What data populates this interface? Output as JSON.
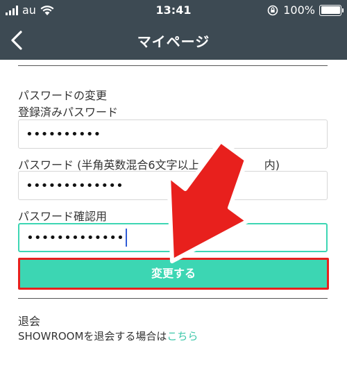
{
  "status_bar": {
    "carrier": "au",
    "time": "13:41",
    "battery_percent": "100%",
    "battery_level": 1.0
  },
  "nav": {
    "title": "マイページ",
    "back_icon": "chevron-left-icon"
  },
  "password_section": {
    "heading": "パスワードの変更",
    "current_label": "登録済みパスワード",
    "current_value": "••••••••••",
    "new_label": "パスワード (半角英数混合6文字以上 3",
    "new_label_tail": "内)",
    "new_value": "•••••••••••••",
    "confirm_label": "パスワード確認用",
    "confirm_value": "•••••••••••••",
    "submit_label": "変更する"
  },
  "withdraw_section": {
    "heading": "退会",
    "text": "SHOWROOMを退会する場合は",
    "link": "こちら"
  },
  "colors": {
    "header_bg": "#3d4a53",
    "accent": "#3cd6b3",
    "highlight_red": "#e8201d",
    "link": "#3cc7a9",
    "caret": "#2f5bd6"
  }
}
